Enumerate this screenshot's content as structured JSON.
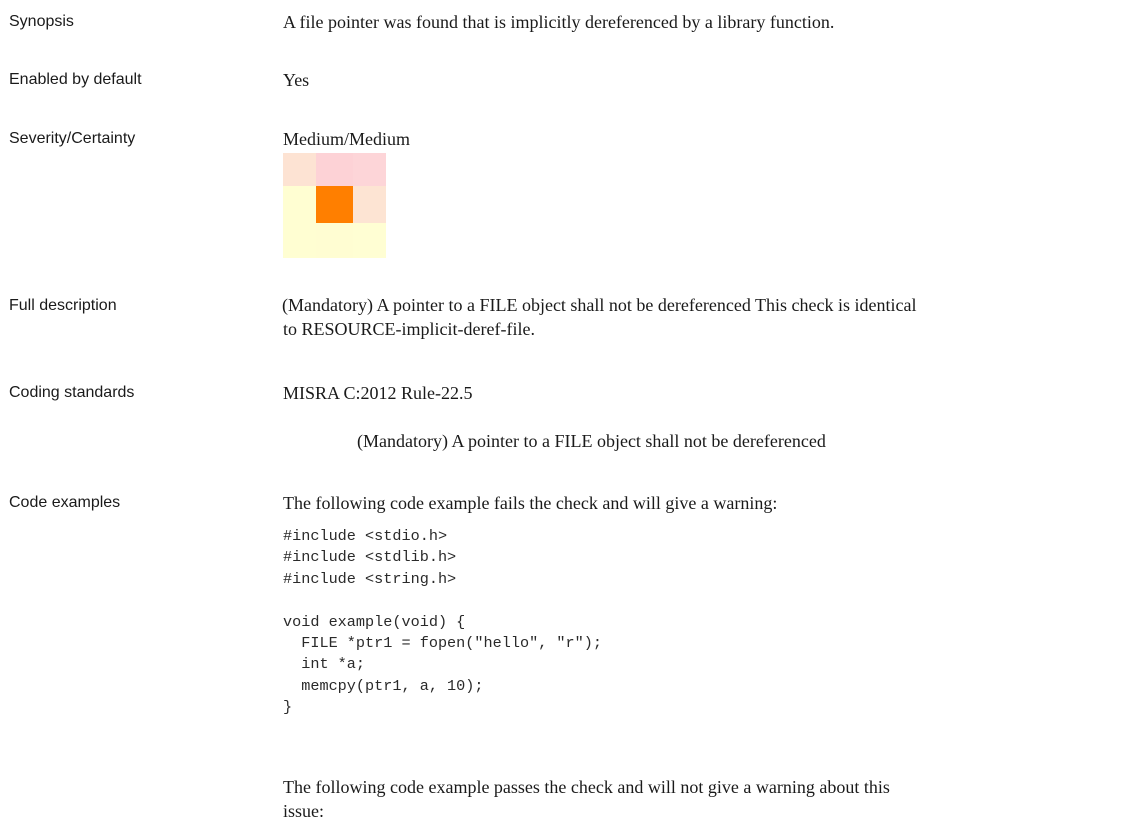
{
  "synopsis": {
    "label": "Synopsis",
    "text": "A file pointer was found that is implicitly dereferenced by a library function."
  },
  "enabled_by_default": {
    "label": "Enabled by default",
    "text": "Yes"
  },
  "severity_certainty": {
    "label": "Severity/Certainty",
    "text": "Medium/Medium",
    "matrix": {
      "rows": 3,
      "cols": 3,
      "colors": [
        [
          "#fde3d3",
          "#fdd2d6",
          "#fdd5d8"
        ],
        [
          "#fffed2",
          "#ff7f00",
          "#fde4d3"
        ],
        [
          "#fffed2",
          "#fffdd2",
          "#fffed3"
        ]
      ],
      "highlighted": {
        "severity": "Medium",
        "certainty": "Medium"
      }
    }
  },
  "full_description": {
    "label": "Full description",
    "lines": [
      "(Mandatory) A pointer to a FILE object shall not be dereferenced This check is identical",
      "to RESOURCE-implicit-deref-file."
    ]
  },
  "coding_standards": {
    "label": "Coding standards",
    "standard": "MISRA C:2012 Rule-22.5",
    "rule_text": "(Mandatory) A pointer to a FILE object shall not be dereferenced"
  },
  "code_examples": {
    "label": "Code examples",
    "fail_intro": "The following code example fails the check and will give a warning:",
    "fail_code": [
      "#include <stdio.h>",
      "#include <stdlib.h>",
      "#include <string.h>",
      "",
      "void example(void) {",
      "  FILE *ptr1 = fopen(\"hello\", \"r\");",
      "  int *a;",
      "  memcpy(ptr1, a, 10);",
      "}"
    ],
    "pass_intro_lines": [
      "The following code example passes the check and will not give a warning about this",
      "issue:"
    ]
  }
}
